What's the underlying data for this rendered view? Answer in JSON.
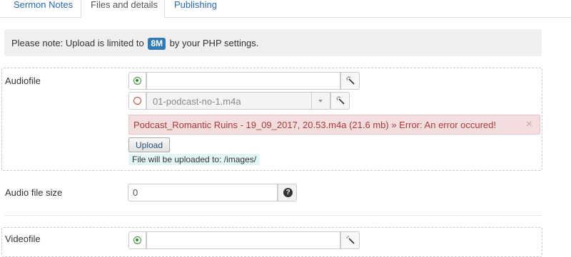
{
  "tabs": [
    {
      "label": "Sermon Notes",
      "active": false
    },
    {
      "label": "Files and details",
      "active": true
    },
    {
      "label": "Publishing",
      "active": false
    }
  ],
  "notice": {
    "prefix": "Please note: Upload is limited to",
    "limit": "8M",
    "suffix": "by your PHP settings."
  },
  "audiofile": {
    "label": "Audiofile",
    "url_input": {
      "value": "",
      "placeholder": ""
    },
    "select": {
      "value": "01-podcast-no-1.m4a"
    },
    "error": {
      "message": "Podcast_Romantic Ruins - 19_09_2017, 20.53.m4a (21.6 mb) » Error: An error occured!",
      "close": "×"
    },
    "upload_button": "Upload",
    "upload_info": "File will be uploaded to: /images/"
  },
  "audio_file_size": {
    "label": "Audio file size",
    "value": "0",
    "help_icon": "?"
  },
  "videofile": {
    "label": "Videofile"
  },
  "colors": {
    "link": "#2a69b8",
    "badge": "#2f7bb8",
    "error_bg": "#f2dede",
    "error_text": "#b03a3a",
    "radio_green": "#3c8a3c",
    "radio_red": "#c43c3c"
  },
  "icons": {
    "selected_radio": "radio-checked-icon",
    "unselected_radio": "radio-unchecked-icon",
    "clear": "magic-wand-icon",
    "dropdown": "chevron-down-icon",
    "help": "question-circle-icon",
    "close": "close-icon"
  }
}
